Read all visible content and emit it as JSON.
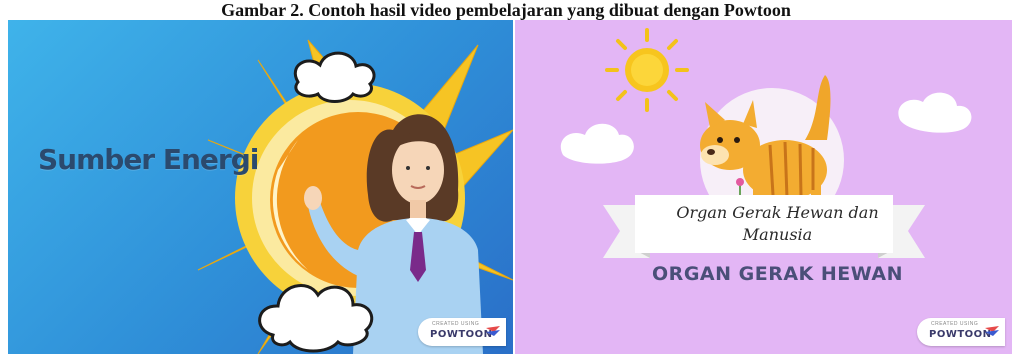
{
  "caption": "Gambar 2. Contoh hasil video pembelajaran yang dibuat dengan Powtoon",
  "left_panel": {
    "title": "Sumber Energi",
    "badge_small": "CREATED USING",
    "badge_brand": "POWTOON"
  },
  "right_panel": {
    "banner_title": "Organ Gerak Hewan dan Manusia",
    "subtitle": "ORGAN GERAK HEWAN",
    "badge_small": "CREATED USING",
    "badge_brand": "POWTOON"
  },
  "colors": {
    "left_background": "#2f8fd8",
    "right_background": "#e3b6f5",
    "sun": "#f7c51e",
    "title_text": "#2b4a6e",
    "subtitle_text": "#4a4f78"
  }
}
